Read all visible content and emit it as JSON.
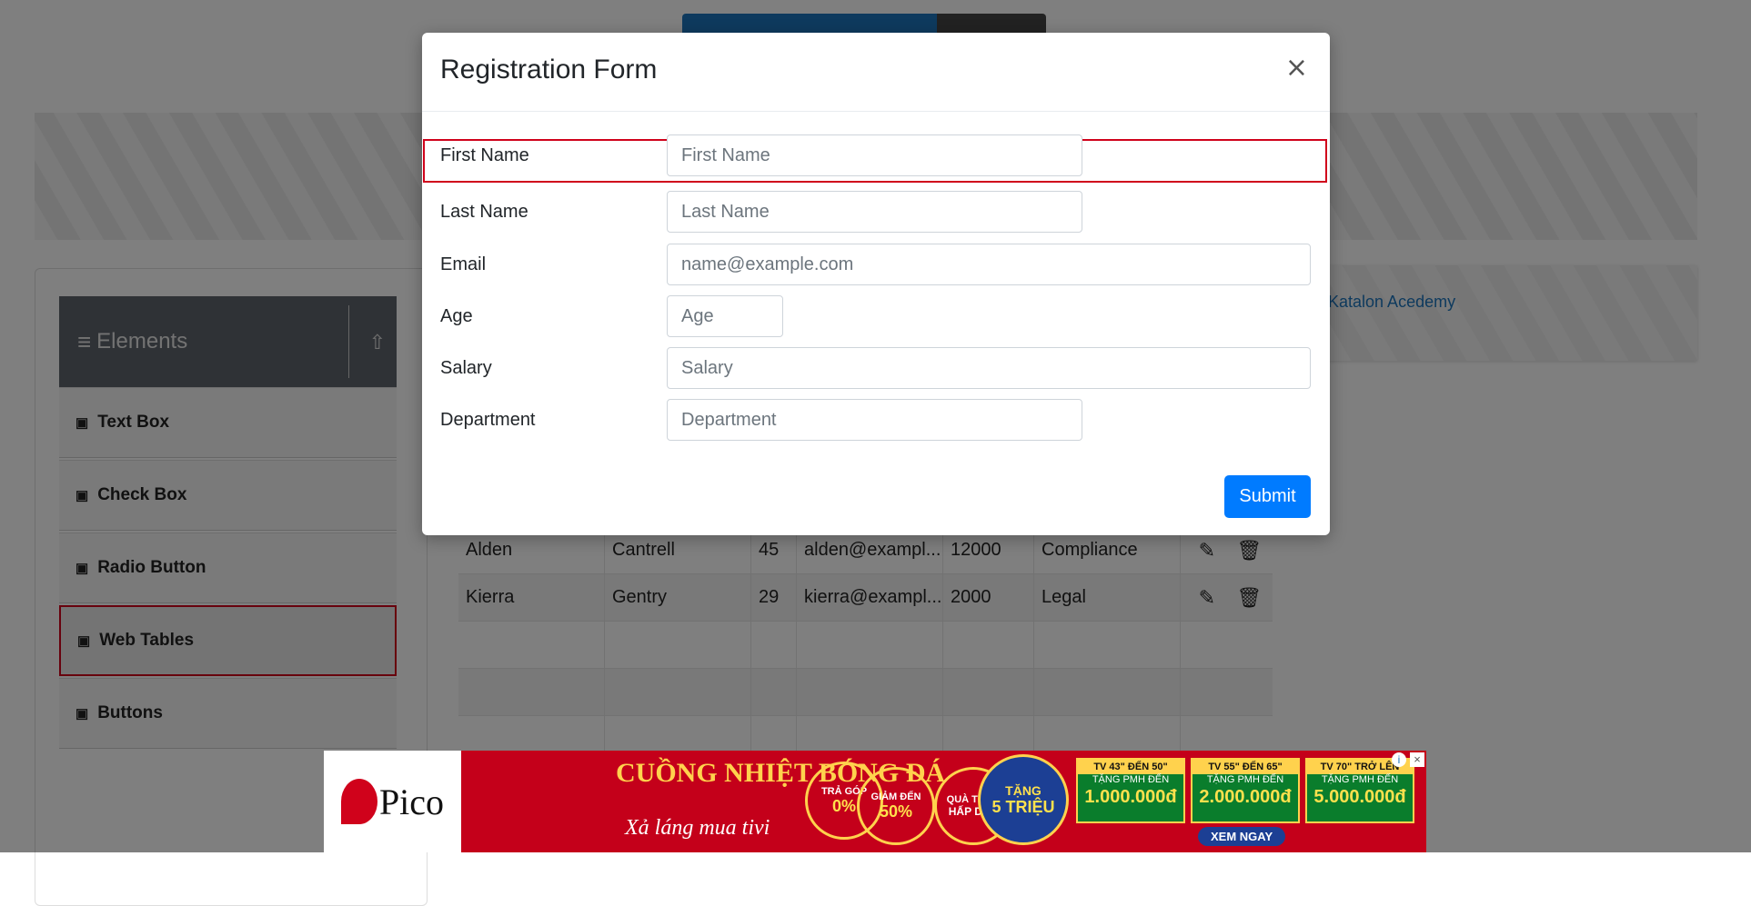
{
  "sidebar": {
    "group_title": "Elements",
    "items": [
      {
        "label": "Text Box"
      },
      {
        "label": "Check Box"
      },
      {
        "label": "Radio Button"
      },
      {
        "label": "Web Tables"
      },
      {
        "label": "Buttons"
      }
    ]
  },
  "right_ad": {
    "alt_text": "Katalon Acedemy"
  },
  "table": {
    "rows": [
      [
        "Alden",
        "Cantrell",
        "45",
        "alden@exampl...",
        "12000",
        "Compliance"
      ],
      [
        "Kierra",
        "Gentry",
        "29",
        "kierra@exampl...",
        "2000",
        "Legal"
      ]
    ]
  },
  "modal": {
    "title": "Registration Form",
    "close_symbol": "×",
    "fields": {
      "first_name": {
        "label": "First Name",
        "placeholder": "First Name",
        "value": ""
      },
      "last_name": {
        "label": "Last Name",
        "placeholder": "Last Name",
        "value": ""
      },
      "email": {
        "label": "Email",
        "placeholder": "name@example.com",
        "value": ""
      },
      "age": {
        "label": "Age",
        "placeholder": "Age",
        "value": ""
      },
      "salary": {
        "label": "Salary",
        "placeholder": "Salary",
        "value": ""
      },
      "department": {
        "label": "Department",
        "placeholder": "Department",
        "value": ""
      }
    },
    "submit_label": "Submit"
  },
  "bottom_ad": {
    "brand": "Pico",
    "headline": "CUỒNG NHIỆT BÓNG ĐÁ",
    "subline": "Xả láng mua tivi",
    "circles": [
      {
        "top": "TRẢ GÓP",
        "big": "0%"
      },
      {
        "top": "GIẢM ĐẾN",
        "big": "50%"
      },
      {
        "top": "QUÀ TẶNG",
        "big": "HẤP DẪN"
      },
      {
        "top": "TẶNG",
        "big": "5 TRIỆU"
      }
    ],
    "cards": [
      {
        "title": "TV 43\" ĐẾN 50\"",
        "sub": "TẶNG PMH ĐẾN",
        "value": "1.000.000đ"
      },
      {
        "title": "TV 55\" ĐẾN 65\"",
        "sub": "TẶNG PMH ĐẾN",
        "value": "2.000.000đ"
      },
      {
        "title": "TV 70\" TRỞ LÊN",
        "sub": "TẶNG PMH ĐẾN",
        "value": "5.000.000đ"
      }
    ],
    "cta": "XEM NGAY",
    "info_symbol": "i",
    "close_symbol": "×"
  }
}
